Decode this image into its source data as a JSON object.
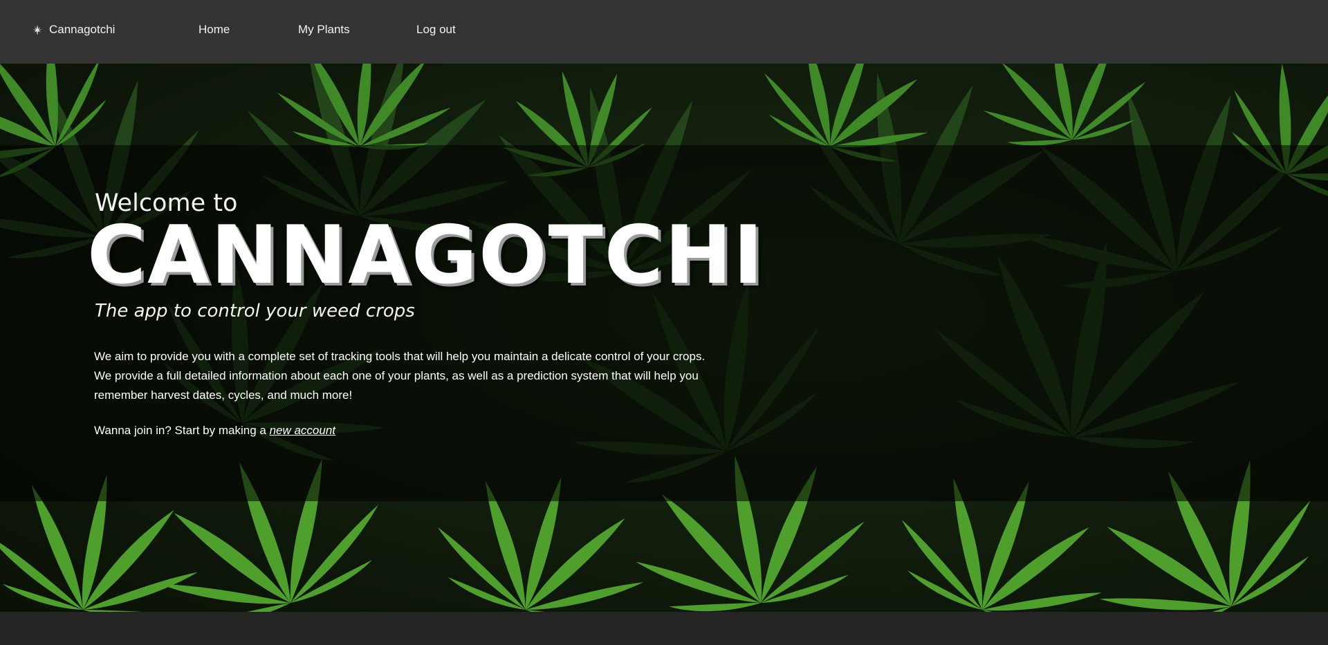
{
  "nav": {
    "brand": "Cannagotchi",
    "brand_icon": "cannabis-leaf-icon",
    "home": "Home",
    "my_plants": "My Plants",
    "log_out": "Log out"
  },
  "hero": {
    "welcome": "Welcome to",
    "title": "CANNAGOTCHI",
    "tagline": "The app to control your weed crops",
    "description_lines": [
      "We aim to provide you with a complete set of tracking tools that will help you maintain a delicate control of your crops.",
      "We provide a full detailed information about each one of your plants, as well as a prediction system that will help you",
      "remember harvest dates, cycles, and much more!"
    ],
    "cta_prefix": "Wanna join in? Start by making a ",
    "cta_link": "new account"
  },
  "colors": {
    "navbar": "#333333",
    "footer": "#242424",
    "leaf_light": "#4e9a2e",
    "leaf_dark": "#1f4a14"
  }
}
